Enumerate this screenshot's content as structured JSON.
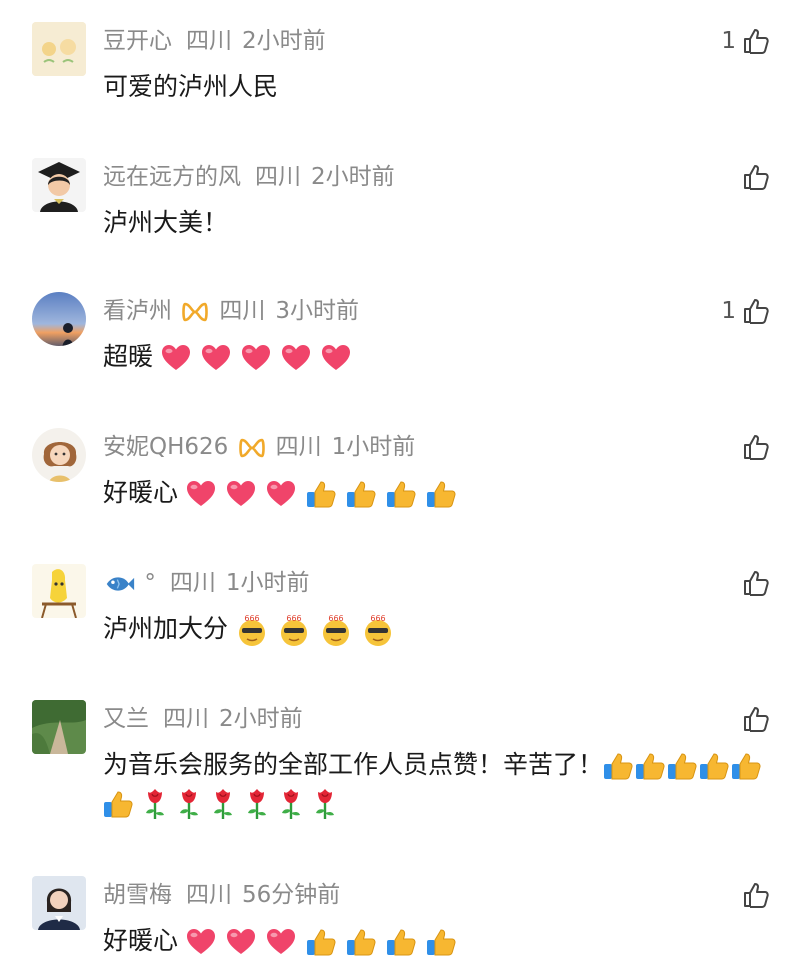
{
  "comments": [
    {
      "user": "豆开心",
      "location": "四川",
      "time": "2小时前",
      "text": "可爱的泸州人民",
      "likes": "1"
    },
    {
      "user": "远在远方的风",
      "location": "四川",
      "time": "2小时前",
      "text": "泸州大美！",
      "likes": ""
    },
    {
      "user": "看泸州",
      "location": "四川",
      "time": "3小时前",
      "text": "超暖",
      "likes": "1"
    },
    {
      "user": "安妮QH626",
      "location": "四川",
      "time": "1小时前",
      "text": "好暖心",
      "likes": ""
    },
    {
      "user": "°",
      "location": "四川",
      "time": "1小时前",
      "text": "泸州加大分",
      "likes": ""
    },
    {
      "user": "又兰",
      "location": "四川",
      "time": "2小时前",
      "text": "为音乐会服务的全部工作人员点赞！辛苦了！",
      "likes": ""
    },
    {
      "user": "胡雪梅",
      "location": "四川",
      "time": "56分钟前",
      "text": "好暖心",
      "likes": ""
    }
  ],
  "emoji_labels": {
    "sixsixsix": "666"
  },
  "icons": {
    "like": "thumbs-up-outline-icon",
    "heart": "red-heart-emoji",
    "thumbs": "thumbs-up-emoji",
    "rose": "rose-emoji",
    "fish": "fish-emoji",
    "badge": "gold-infinity-badge-icon"
  },
  "colors": {
    "meta": "#8a8a8a",
    "text": "#1a1a1a",
    "heart": "#f0446a",
    "gold": "#f5b52a"
  }
}
